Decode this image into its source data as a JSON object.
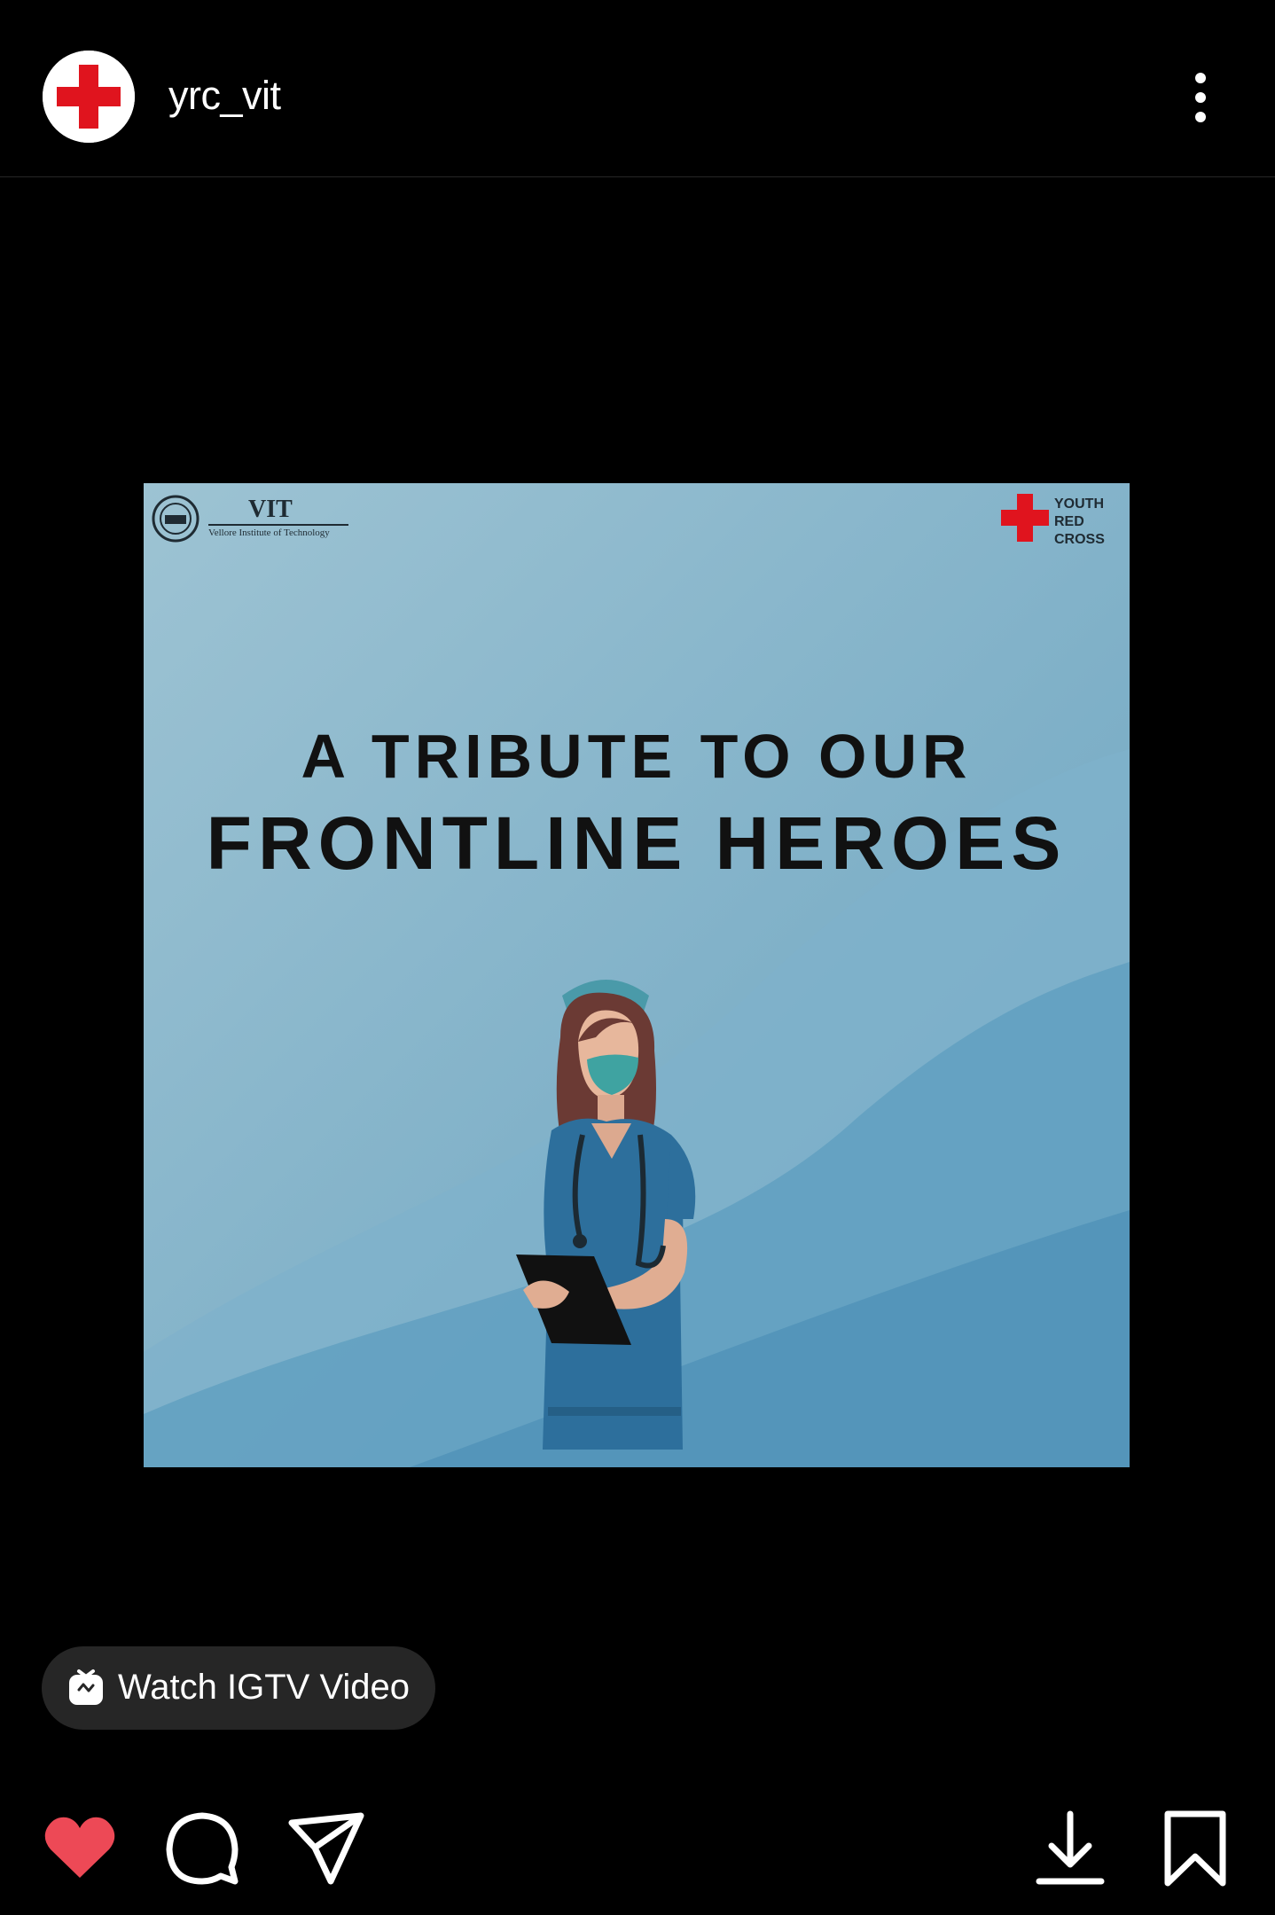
{
  "header": {
    "username": "yrc_vit"
  },
  "poster": {
    "institute_name": "VIT",
    "institute_subtitle": "Vellore Institute of Technology",
    "badge_lines": [
      "YOUTH",
      "RED",
      "CROSS"
    ],
    "headline_line1": "A TRIBUTE TO OUR",
    "headline_line2": "FRONTLINE HEROES"
  },
  "igtv": {
    "label": "Watch IGTV Video"
  },
  "actions": {
    "like_state": "liked",
    "icons": [
      "heart-icon",
      "comment-icon",
      "share-icon",
      "download-icon",
      "bookmark-icon"
    ]
  },
  "colors": {
    "background": "#000000",
    "like_red": "#ed4956",
    "brand_red": "#e0141e",
    "poster_blue": "#8fb8cc"
  }
}
